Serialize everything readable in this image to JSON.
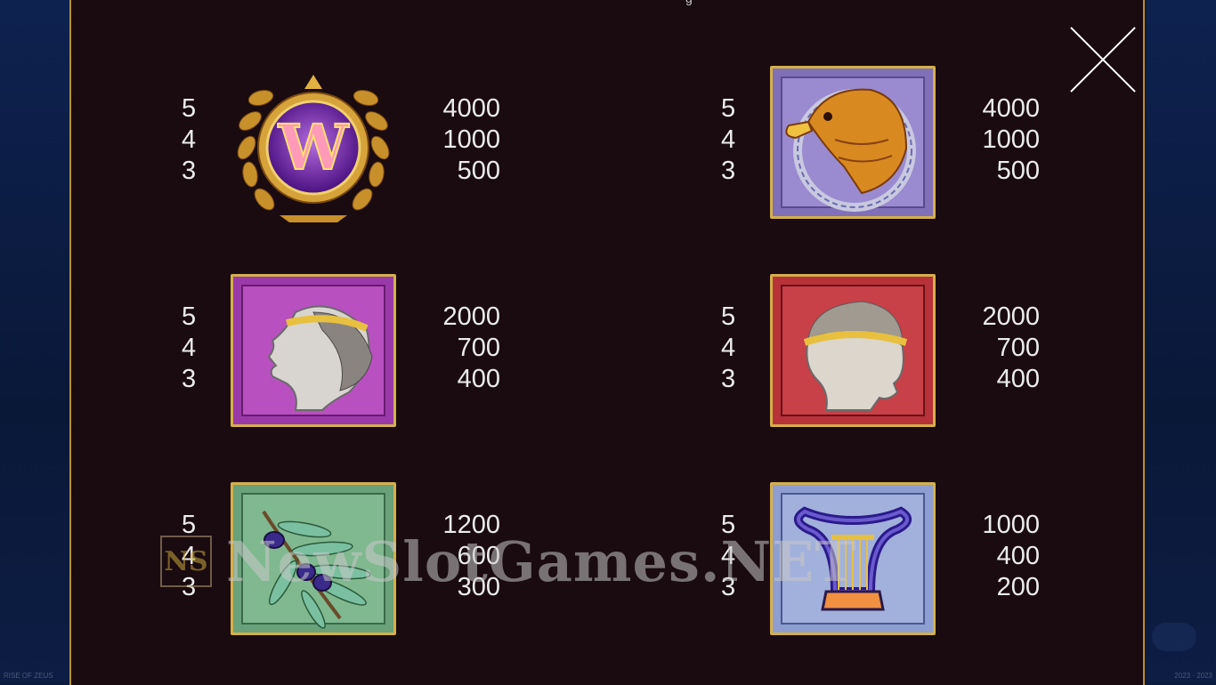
{
  "header": {
    "title_fragment": "g"
  },
  "close_button": {
    "icon": "close-icon"
  },
  "symbols": [
    {
      "id": "wild",
      "icon": "wild-w-laurel-icon",
      "letter": "W",
      "counts": [
        "5",
        "4",
        "3"
      ],
      "payouts": [
        "4000",
        "1000",
        "500"
      ]
    },
    {
      "id": "eagle",
      "icon": "eagle-icon",
      "counts": [
        "5",
        "4",
        "3"
      ],
      "payouts": [
        "4000",
        "1000",
        "500"
      ]
    },
    {
      "id": "woman-head",
      "icon": "woman-profile-icon",
      "counts": [
        "5",
        "4",
        "3"
      ],
      "payouts": [
        "2000",
        "700",
        "400"
      ]
    },
    {
      "id": "man-head",
      "icon": "man-profile-icon",
      "counts": [
        "5",
        "4",
        "3"
      ],
      "payouts": [
        "2000",
        "700",
        "400"
      ]
    },
    {
      "id": "olive",
      "icon": "olive-branch-icon",
      "counts": [
        "5",
        "4",
        "3"
      ],
      "payouts": [
        "1200",
        "600",
        "300"
      ]
    },
    {
      "id": "lyre",
      "icon": "lyre-icon",
      "counts": [
        "5",
        "4",
        "3"
      ],
      "payouts": [
        "1000",
        "400",
        "200"
      ]
    }
  ],
  "watermark": {
    "logo": "NS",
    "text": "NewSlotGames.NET"
  },
  "background": {
    "footer_left": "RISE OF ZEUS",
    "footer_right": "2023 · 2023"
  },
  "colors": {
    "panel_bg": "#1a0b10",
    "panel_border": "#b8902e",
    "tile_border": "#d4b04a",
    "text": "#ececec",
    "purple_tile": "#9a3aa8",
    "red_tile": "#b8323a",
    "green_tile": "#6aa07a",
    "blue_tile": "#8e9ed0",
    "violet_tile": "#8070b8"
  }
}
